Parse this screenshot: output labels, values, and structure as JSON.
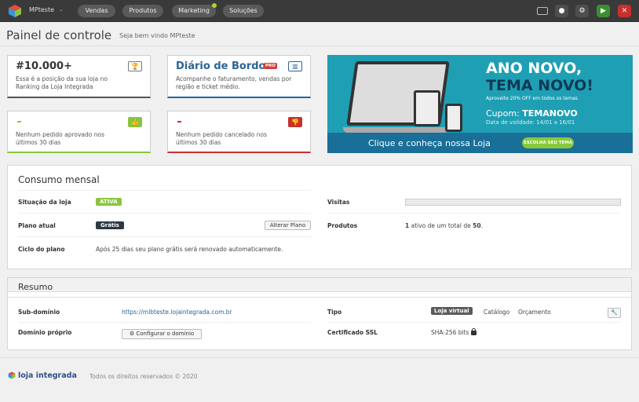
{
  "topbar": {
    "store_name": "MPteste",
    "store_caret": "⌄",
    "nav": [
      "Vendas",
      "Produtos",
      "Marketing",
      "Soluções"
    ],
    "icons": [
      "screen-icon",
      "eye-icon",
      "gear-icon",
      "play-icon",
      "close-icon"
    ]
  },
  "header": {
    "title": "Painel de controle",
    "subtitle": "Seja bem vindo MPteste"
  },
  "cards": {
    "ranking": {
      "title": "#10.000+",
      "desc": "Essa é a posição da sua loja no Ranking da Loja Integrada",
      "icon": "trophy-icon"
    },
    "diario": {
      "title": "Diário de Bordo",
      "badge": "PRO",
      "desc": "Acompanhe o faturamento, vendas por região e ticket médio.",
      "icon": "chart-icon"
    },
    "aprovados": {
      "desc": "Nenhum pedido aprovado nos últimos 30 dias",
      "icon": "thumbs-up-icon",
      "color": "#8ac43f"
    },
    "cancelados": {
      "desc": "Nenhum pedido cancelado nos últimos 30 dias",
      "icon": "thumbs-down-icon",
      "color": "#c9302c"
    }
  },
  "banner": {
    "line1": "ANO NOVO,",
    "line2": "TEMA NOVO!",
    "small": "Aproveite 20% OFF em todos os temas",
    "coupon_label": "Cupom:",
    "coupon_code": "TEMANOVO",
    "validity": "Data de validade: 14/01 a 16/01",
    "cta": "Clique e conheça nossa Loja",
    "button": "ESCOLHA SEU TEMA"
  },
  "consumo": {
    "title": "Consumo mensal",
    "situacao_label": "Situação da loja",
    "situacao_value": "ATIVA",
    "plano_label": "Plano atual",
    "plano_value": "Grátis",
    "alterar_button": "Alterar Plano",
    "ciclo_label": "Ciclo do plano",
    "ciclo_value": "Após 25 dias seu plano grátis será renovado automaticamente.",
    "visitas_label": "Visitas",
    "visitas_progress": 0,
    "produtos_label": "Produtos",
    "produtos_count": "1",
    "produtos_mid": " ativo de um total de ",
    "produtos_total": "50",
    "produtos_end": "."
  },
  "resumo": {
    "title": "Resumo",
    "subdominio_label": "Sub-domínio",
    "subdominio_value": "https://mlbteste.lojaintegrada.com.br",
    "dominio_label": "Domínio próprio",
    "dominio_button": "Configurar o domínio",
    "tipo_label": "Tipo",
    "tipo_options": [
      "Loja virtual",
      "Catálogo",
      "Orçamento"
    ],
    "ssl_label": "Certificado SSL",
    "ssl_value": "SHA-256 bits"
  },
  "footer": {
    "brand": "loja integrada",
    "copyright": "Todos os direitos reservados © 2020"
  }
}
